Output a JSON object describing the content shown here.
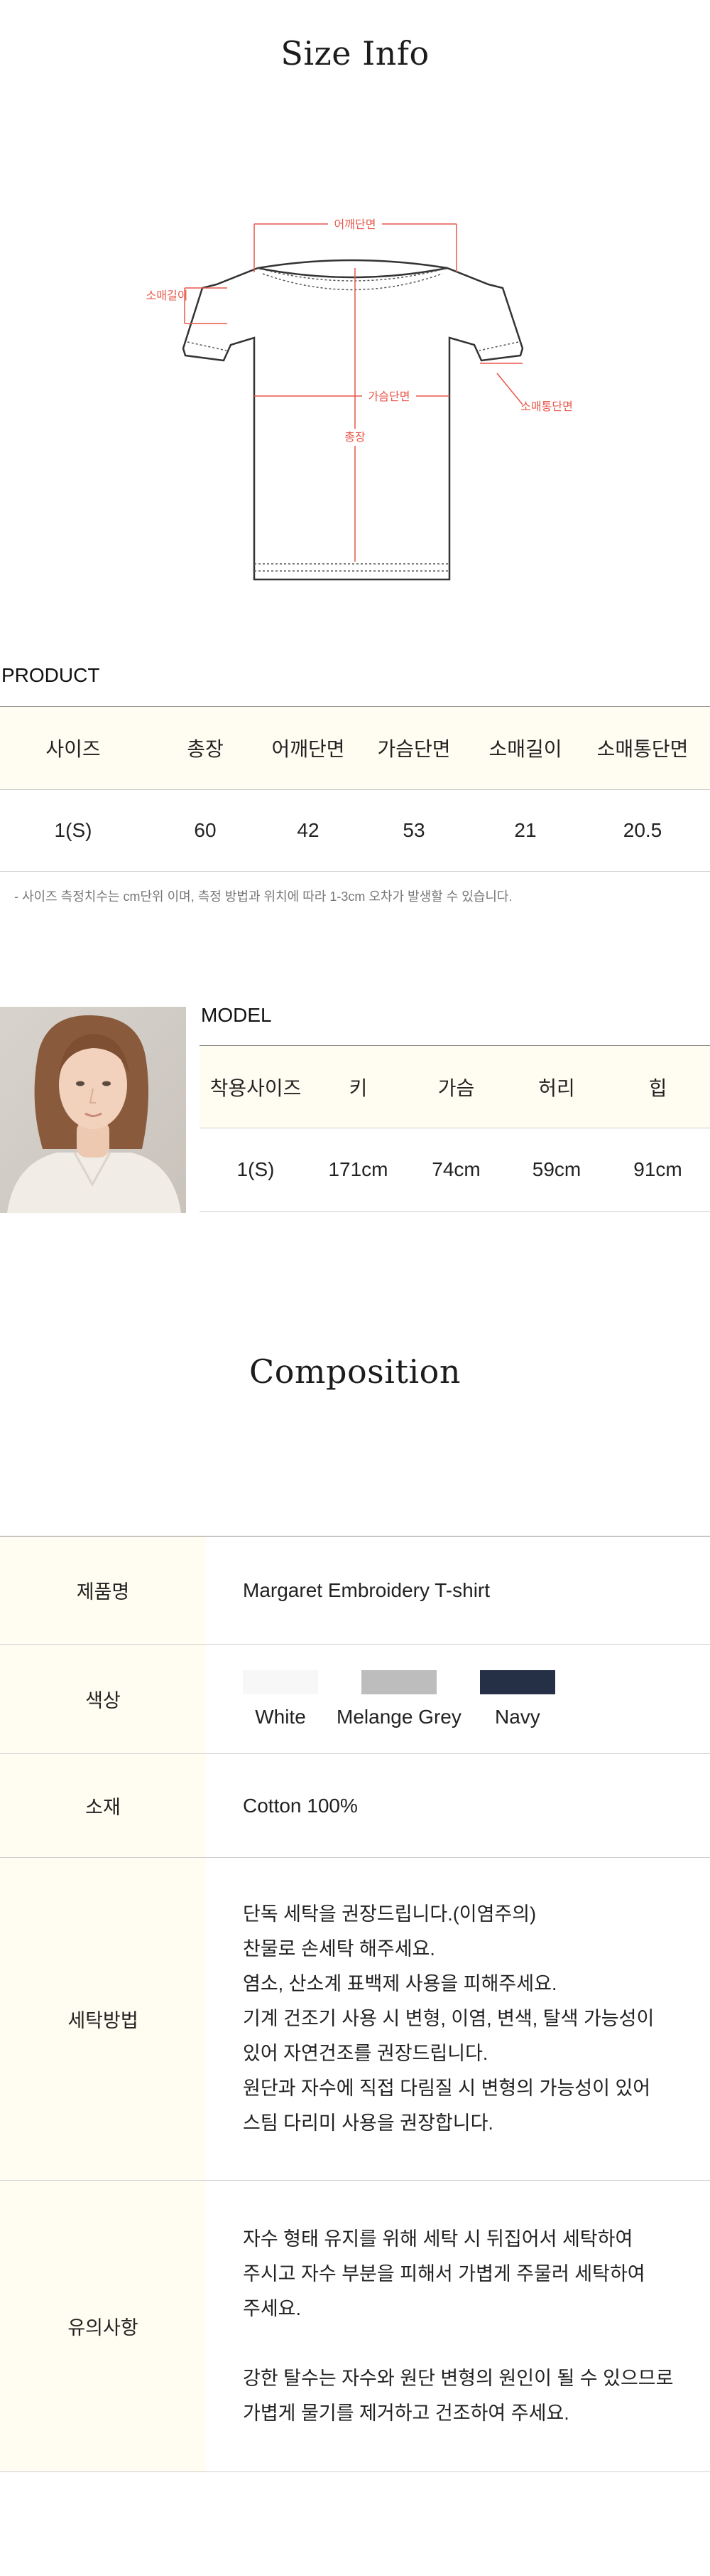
{
  "size_info": {
    "title": "Size Info",
    "diagram_labels": {
      "shoulder": "어깨단면",
      "sleeve_length": "소매길이",
      "chest": "가슴단면",
      "length": "총장",
      "sleeve_opening": "소매통단면"
    }
  },
  "product": {
    "label": "PRODUCT",
    "headers": [
      "사이즈",
      "총장",
      "어깨단면",
      "가슴단면",
      "소매길이",
      "소매통단면"
    ],
    "rows": [
      [
        "1(S)",
        "60",
        "42",
        "53",
        "21",
        "20.5"
      ]
    ],
    "note": "- 사이즈 측정치수는 cm단위 이며, 측정 방법과 위치에 따라 1-3cm 오차가 발생할 수 있습니다."
  },
  "model": {
    "label": "MODEL",
    "headers": [
      "착용사이즈",
      "키",
      "가슴",
      "허리",
      "힙"
    ],
    "rows": [
      [
        "1(S)",
        "171cm",
        "74cm",
        "59cm",
        "91cm"
      ]
    ]
  },
  "composition": {
    "title": "Composition",
    "product_name_label": "제품명",
    "product_name": "Margaret Embroidery T-shirt",
    "color_label": "색상",
    "colors": [
      {
        "name": "White",
        "hex": "#f7f7f7"
      },
      {
        "name": "Melange Grey",
        "hex": "#bdbdbd"
      },
      {
        "name": "Navy",
        "hex": "#253047"
      }
    ],
    "material_label": "소재",
    "material": "Cotton 100%",
    "wash_label": "세탁방법",
    "wash_lines": [
      "단독 세탁을 권장드립니다.(이염주의)",
      "찬물로 손세탁 해주세요.",
      "염소, 산소계 표백제 사용을 피해주세요.",
      "기계 건조기 사용 시 변형, 이염, 변색, 탈색 가능성이",
      "있어 자연건조를 권장드립니다.",
      "원단과 자수에 직접 다림질 시 변형의 가능성이 있어",
      "스팀 다리미 사용을 권장합니다."
    ],
    "caution_label": "유의사항",
    "caution_lines": [
      "자수 형태 유지를 위해 세탁 시 뒤집어서 세탁하여",
      "주시고 자수 부분을 피해서 가볍게 주물러 세탁하여",
      "주세요.",
      "",
      "강한 탈수는 자수와 원단 변형의 원인이 될 수 있으므로",
      "가볍게 물기를 제거하고 건조하여 주세요."
    ]
  },
  "colors": {
    "accent_red": "#e8574a",
    "header_bg": "#fffcf1",
    "text": "#222222"
  }
}
